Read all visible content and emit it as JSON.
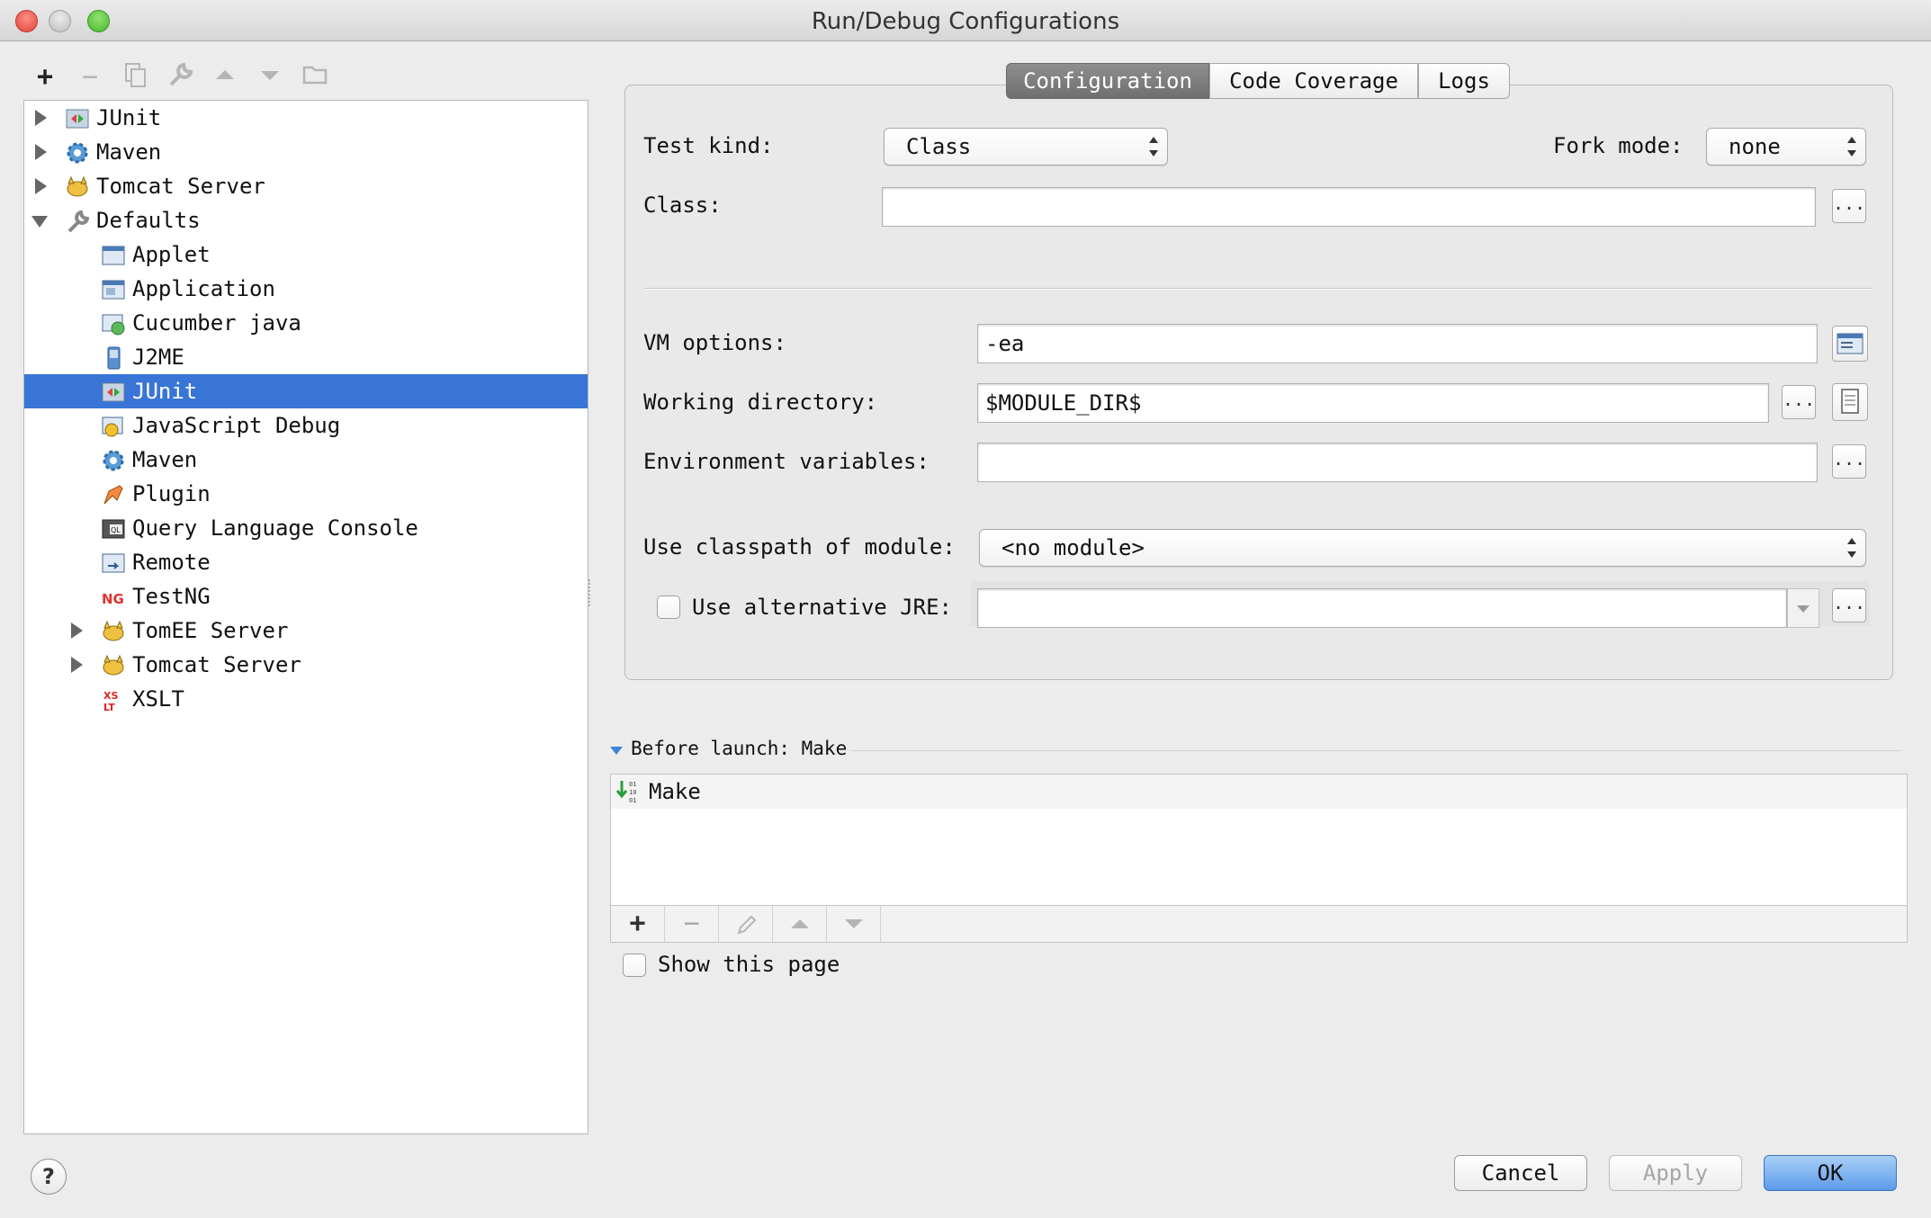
{
  "window": {
    "title": "Run/Debug Configurations"
  },
  "toolbar": {
    "add": "+",
    "remove": "−"
  },
  "tree": {
    "items": [
      {
        "label": "JUnit"
      },
      {
        "label": "Maven"
      },
      {
        "label": "Tomcat Server"
      },
      {
        "label": "Defaults"
      },
      {
        "label": "Applet"
      },
      {
        "label": "Application"
      },
      {
        "label": "Cucumber java"
      },
      {
        "label": "J2ME"
      },
      {
        "label": "JUnit"
      },
      {
        "label": "JavaScript Debug"
      },
      {
        "label": "Maven"
      },
      {
        "label": "Plugin"
      },
      {
        "label": "Query Language Console"
      },
      {
        "label": "Remote"
      },
      {
        "label": "TestNG"
      },
      {
        "label": "TomEE Server"
      },
      {
        "label": "Tomcat Server"
      },
      {
        "label": "XSLT"
      }
    ],
    "selected": "JUnit"
  },
  "tabs": [
    {
      "label": "Configuration"
    },
    {
      "label": "Code Coverage"
    },
    {
      "label": "Logs"
    }
  ],
  "config": {
    "test_kind_label": "Test kind:",
    "test_kind_value": "Class",
    "fork_mode_label": "Fork mode:",
    "fork_mode_value": "none",
    "class_label": "Class:",
    "class_value": "",
    "vm_options_label": "VM options:",
    "vm_options_value": "-ea",
    "working_dir_label": "Working directory:",
    "working_dir_value": "$MODULE_DIR$",
    "env_vars_label": "Environment variables:",
    "env_vars_value": "",
    "classpath_label": "Use classpath of module:",
    "classpath_value": "<no module>",
    "alt_jre_label": "Use alternative JRE:",
    "alt_jre_value": "",
    "ellipsis": "..."
  },
  "before_launch": {
    "header": "Before launch: Make",
    "items": [
      {
        "label": "Make"
      }
    ],
    "add": "+",
    "remove": "−"
  },
  "show_page_label": "Show this page",
  "help": "?",
  "buttons": {
    "cancel": "Cancel",
    "apply": "Apply",
    "ok": "OK"
  },
  "colors": {
    "selection": "#3875d7",
    "ok_button": "#5d9be9"
  }
}
